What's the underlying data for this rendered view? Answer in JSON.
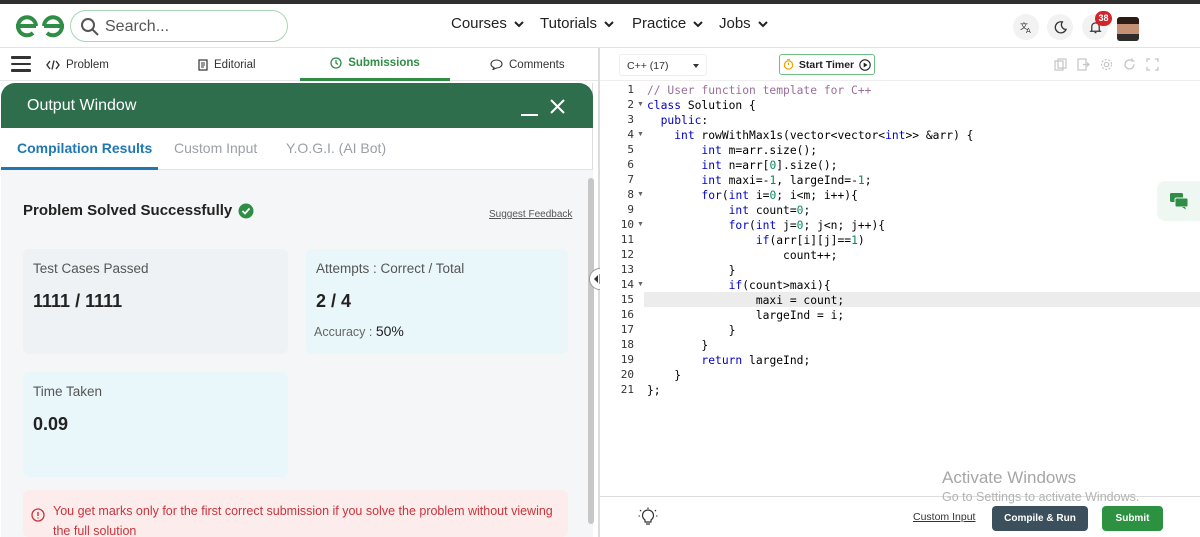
{
  "nav": {
    "search_placeholder": "Search...",
    "menu": [
      "Courses",
      "Tutorials",
      "Practice",
      "Jobs"
    ],
    "notification_count": "38"
  },
  "problem_tabs": [
    "Problem",
    "Editorial",
    "Submissions",
    "Comments"
  ],
  "output_window": {
    "title": "Output Window",
    "tabs": [
      "Compilation Results",
      "Custom Input",
      "Y.O.G.I. (AI Bot)"
    ],
    "status": "Problem Solved Successfully",
    "suggest_feedback": "Suggest Feedback",
    "test_cases_label": "Test Cases Passed",
    "test_cases_value": "1111 / 1111",
    "attempts_label": "Attempts : Correct / Total",
    "attempts_value": "2 / 4",
    "accuracy_label": "Accuracy :",
    "accuracy_value": "50%",
    "time_label": "Time Taken",
    "time_value": "0.09",
    "warning": "You get marks only for the first correct submission if you solve the problem without viewing the full solution"
  },
  "editor": {
    "language": "C++ (17)",
    "timer_label": "Start Timer",
    "current_line": 15,
    "lines": [
      "// User function template for C++",
      "class Solution {",
      "  public:",
      "    int rowWithMax1s(vector<vector<int>> &arr) {",
      "        int m=arr.size();",
      "        int n=arr[0].size();",
      "        int maxi=-1, largeInd=-1;",
      "        for(int i=0; i<m; i++){",
      "            int count=0;",
      "            for(int j=0; j<n; j++){",
      "                if(arr[i][j]==1)",
      "                    count++;",
      "            }",
      "            if(count>maxi){",
      "                maxi = count;",
      "                largeInd = i;",
      "            }",
      "        }",
      "        return largeInd;",
      "    }",
      "};"
    ],
    "foldable_lines": [
      2,
      4,
      8,
      10,
      14
    ],
    "custom_input_label": "Custom Input",
    "compile_label": "Compile & Run",
    "submit_label": "Submit"
  },
  "watermark": {
    "line1": "Activate Windows",
    "line2": "Go to Settings to activate Windows."
  },
  "colors": {
    "brand_green": "#2f8d46",
    "header_green": "#2f6e4c",
    "tab_blue": "#1f78b4",
    "warning_red": "#c7353b"
  }
}
